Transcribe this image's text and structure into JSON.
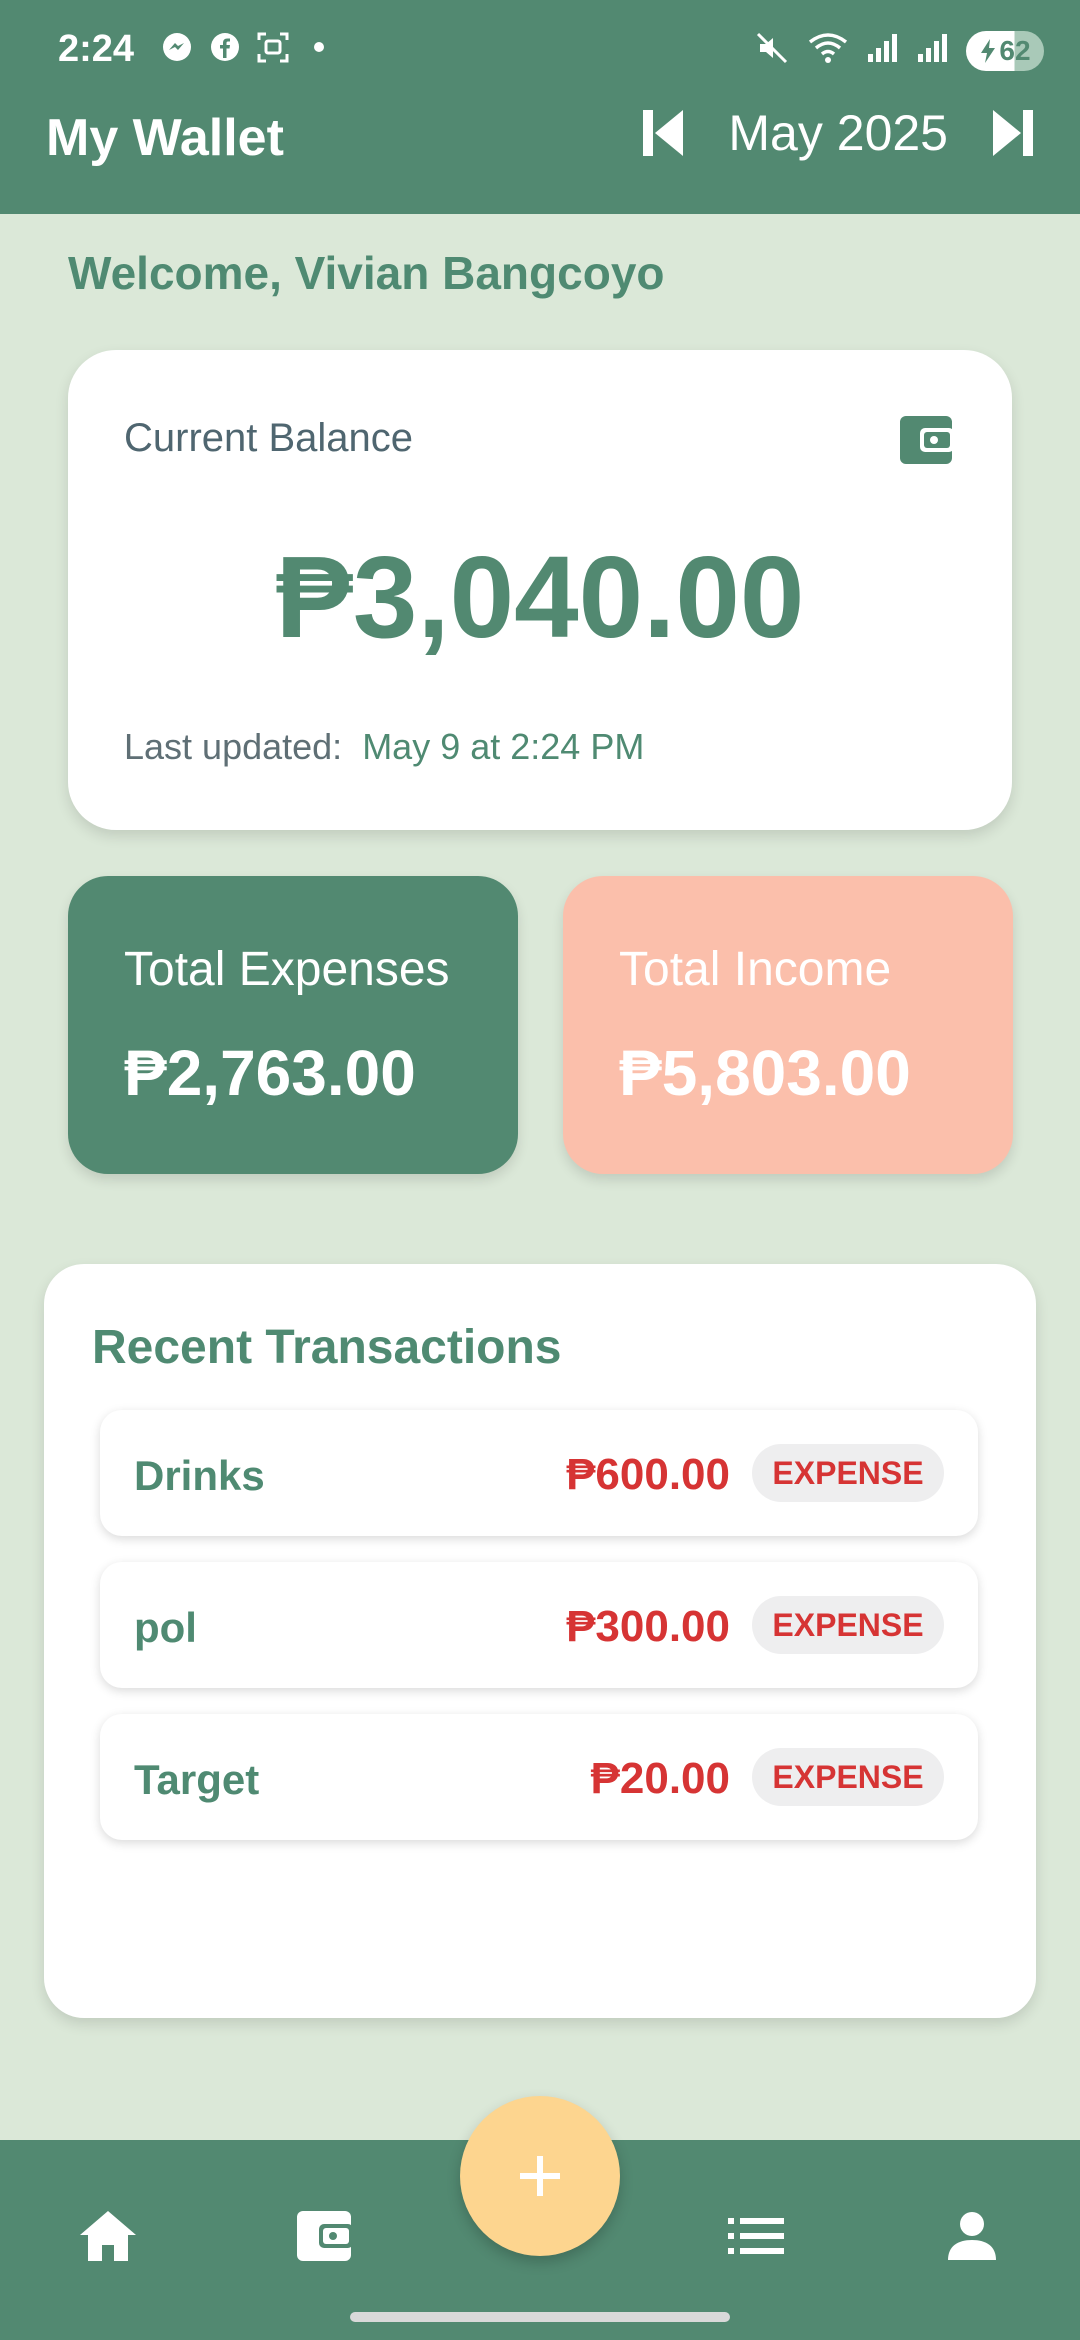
{
  "status_bar": {
    "time": "2:24",
    "battery": "62"
  },
  "header": {
    "title": "My Wallet",
    "month": "May 2025"
  },
  "welcome": "Welcome, Vivian Bangcoyo",
  "balance": {
    "label": "Current Balance",
    "amount": "₱3,040.00",
    "updated_label": "Last updated:",
    "updated_value": "May 9 at 2:24 PM"
  },
  "expenses": {
    "label": "Total Expenses",
    "amount": "₱2,763.00"
  },
  "income": {
    "label": "Total Income",
    "amount": "₱5,803.00"
  },
  "recent": {
    "title": "Recent Transactions",
    "items": [
      {
        "name": "Drinks",
        "amount": "₱600.00",
        "type": "EXPENSE"
      },
      {
        "name": "pol",
        "amount": "₱300.00",
        "type": "EXPENSE"
      },
      {
        "name": "Target",
        "amount": "₱20.00",
        "type": "EXPENSE"
      }
    ]
  },
  "colors": {
    "primary": "#528971",
    "background": "#dbe8d8",
    "income": "#fbbfab",
    "fab": "#fdd58f",
    "expense_text": "#d63434"
  },
  "icons": {
    "bottom_nav": [
      "home-icon",
      "wallet-icon",
      "add-icon",
      "list-icon",
      "profile-icon"
    ]
  }
}
